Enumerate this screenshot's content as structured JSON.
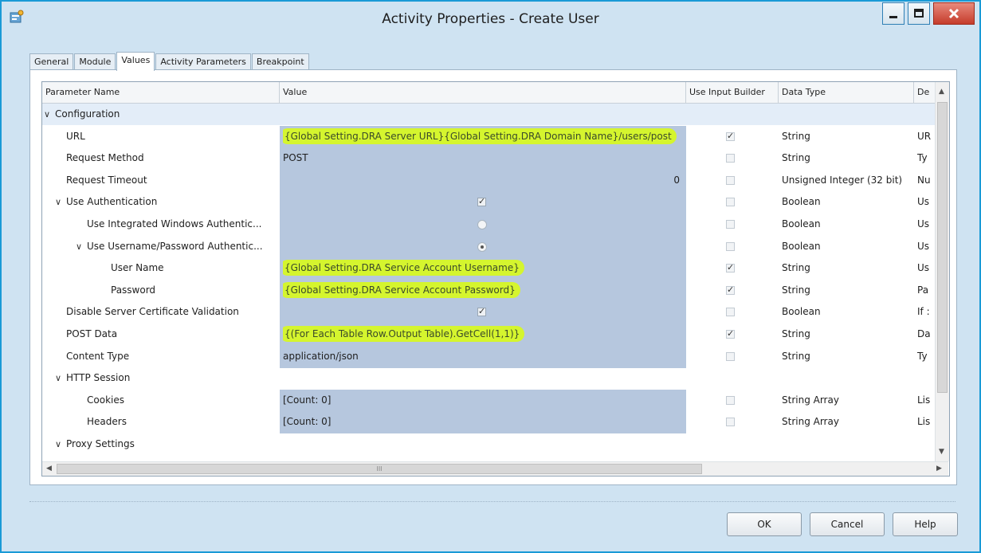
{
  "window": {
    "title": "Activity Properties - Create User",
    "accent_color": "#1a9ad6",
    "icon": "properties-icon"
  },
  "tabs": [
    {
      "label": "General",
      "active": false
    },
    {
      "label": "Module",
      "active": false
    },
    {
      "label": "Values",
      "active": true
    },
    {
      "label": "Activity Parameters",
      "active": false
    },
    {
      "label": "Breakpoint",
      "active": false
    }
  ],
  "grid": {
    "headers": {
      "parameter_name": "Parameter Name",
      "value": "Value",
      "use_input_builder": "Use Input Builder",
      "data_type": "Data Type",
      "description": "De"
    },
    "highlight_color": "#d5f52e",
    "value_fill_color": "#b6c7de",
    "rows": [
      {
        "name": "Configuration",
        "group": true,
        "expanded": true
      },
      {
        "name": "URL",
        "value": "{Global Setting.DRA Server URL}{Global Setting.DRA Domain Name}/users/post",
        "highlight": true,
        "input_builder": true,
        "data_type": "String",
        "description": "UR"
      },
      {
        "name": "Request Method",
        "value": "POST",
        "input_builder": false,
        "data_type": "String",
        "description": "Ty"
      },
      {
        "name": "Request Timeout",
        "value": "0",
        "value_align": "right",
        "input_builder": false,
        "data_type": "Unsigned Integer (32 bit)",
        "description": "Nu"
      },
      {
        "name": "Use Authentication",
        "expandable": true,
        "value_control": "checkbox",
        "value_checked": true,
        "input_builder": false,
        "data_type": "Boolean",
        "description": "Us"
      },
      {
        "name": "Use Integrated Windows Authentic...",
        "value_control": "radio",
        "value_checked": false,
        "input_builder": false,
        "data_type": "Boolean",
        "description": "Us"
      },
      {
        "name": "Use Username/Password Authentic...",
        "expandable": true,
        "value_control": "radio",
        "value_checked": true,
        "input_builder": false,
        "data_type": "Boolean",
        "description": "Us"
      },
      {
        "name": "User Name",
        "value": "{Global Setting.DRA Service Account Username}",
        "highlight": true,
        "input_builder": true,
        "data_type": "String",
        "description": "Us"
      },
      {
        "name": "Password",
        "value": "{Global Setting.DRA Service Account Password}",
        "highlight": true,
        "input_builder": true,
        "data_type": "String",
        "description": "Pa"
      },
      {
        "name": "Disable Server Certificate Validation",
        "value_control": "checkbox",
        "value_checked": true,
        "input_builder": false,
        "data_type": "Boolean",
        "description": "If :"
      },
      {
        "name": "POST Data",
        "value": "{(For Each Table Row.Output Table).GetCell(1,1)}",
        "highlight": true,
        "input_builder": true,
        "data_type": "String",
        "description": "Da"
      },
      {
        "name": "Content Type",
        "value": "application/json",
        "input_builder": false,
        "data_type": "String",
        "description": "Ty"
      },
      {
        "name": "HTTP Session",
        "expandable": true
      },
      {
        "name": "Cookies",
        "value": "[Count: 0]",
        "input_builder": false,
        "data_type": "String Array",
        "description": "Lis"
      },
      {
        "name": "Headers",
        "value": "[Count: 0]",
        "input_builder": false,
        "data_type": "String Array",
        "description": "Lis"
      },
      {
        "name": "Proxy Settings",
        "expandable": true
      }
    ]
  },
  "scrollbars": {
    "up_arrow": "▲",
    "down_arrow": "▼",
    "left_arrow": "◀",
    "right_arrow": "▶",
    "thumb_grip": "III"
  },
  "buttons": {
    "ok": "OK",
    "cancel": "Cancel",
    "help": "Help"
  }
}
